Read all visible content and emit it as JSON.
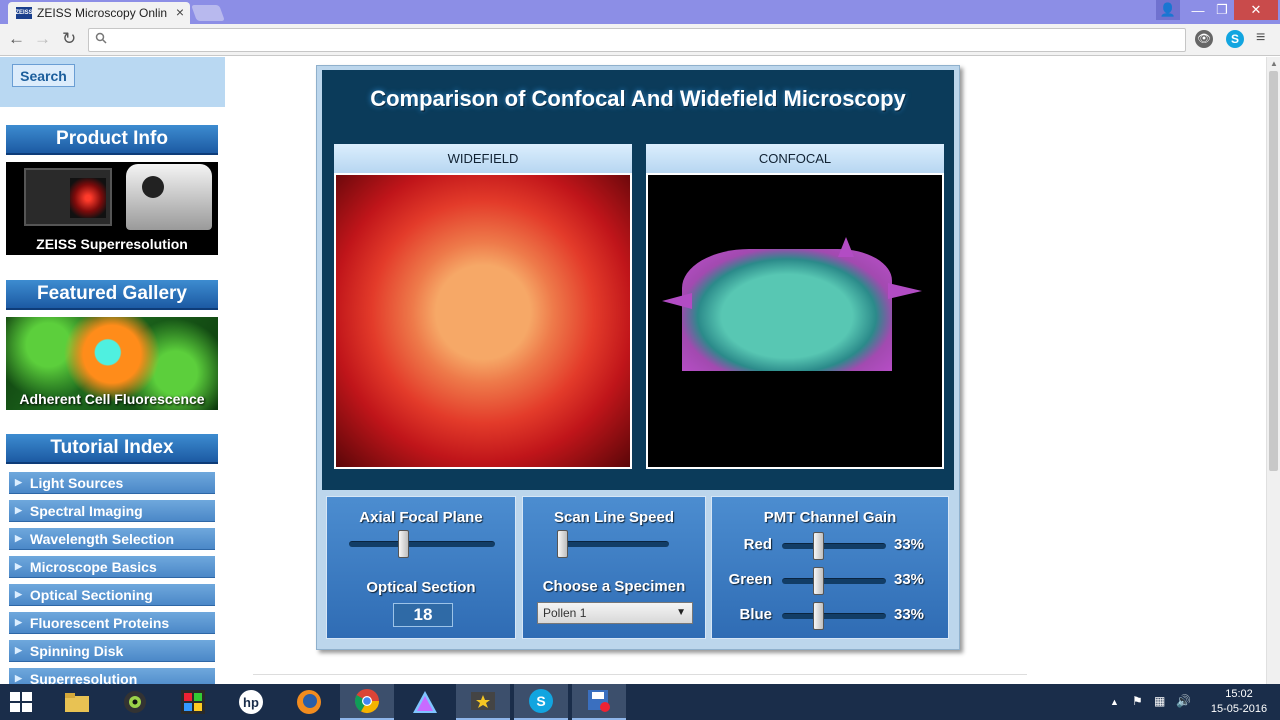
{
  "browser": {
    "tab_title": "ZEISS Microscopy Online C",
    "tab_logo_text": "ZEISS",
    "close_glyph": "×",
    "window_buttons": {
      "profile": "👤",
      "minimize": "—",
      "maximize": "❐",
      "close": "✕"
    },
    "nav": {
      "back": "←",
      "forward": "→",
      "reload": "↻",
      "menu": "≡"
    },
    "omnibox_value": "",
    "extensions": {
      "eye": "👁",
      "skype": "S"
    }
  },
  "sidebar": {
    "search_label": "Search",
    "product_info_header": "Product Info",
    "product_caption": "ZEISS Superresolution",
    "gallery_header": "Featured Gallery",
    "gallery_caption": "Adherent Cell Fluorescence",
    "tutorial_header": "Tutorial Index",
    "tutorial_items": [
      "Light Sources",
      "Spectral Imaging",
      "Wavelength Selection",
      "Microscope Basics",
      "Optical Sectioning",
      "Fluorescent Proteins",
      "Spinning Disk",
      "Superresolution"
    ]
  },
  "applet": {
    "title": "Comparison of Confocal And Widefield Microscopy",
    "widefield_label": "WIDEFIELD",
    "confocal_label": "CONFOCAL",
    "axial_label": "Axial Focal Plane",
    "axial_value": 0.36,
    "optical_section_label": "Optical Section",
    "optical_section_value": "18",
    "scan_speed_label": "Scan Line Speed",
    "scan_speed_value": 0.0,
    "specimen_label": "Choose a Specimen",
    "specimen_value": "Pollen 1",
    "specimen_arrow": "▼",
    "pmt_label": "PMT Channel Gain",
    "gains": [
      {
        "name": "Red",
        "percent": "33%",
        "value": 0.33
      },
      {
        "name": "Green",
        "percent": "33%",
        "value": 0.33
      },
      {
        "name": "Blue",
        "percent": "33%",
        "value": 0.33
      }
    ]
  },
  "taskbar": {
    "apps": [
      "file-explorer",
      "app-eye",
      "app-colors",
      "hp",
      "firefox",
      "chrome",
      "app-prism",
      "movie-maker",
      "skype",
      "app-record"
    ],
    "tray": {
      "up_arrow": "▲",
      "flag": "⚑",
      "network": "▦",
      "volume": "🔊"
    },
    "time": "15:02",
    "date": "15-05-2016"
  },
  "colors": {
    "titlebar": "#8c8ee6",
    "applet_bg": "#0b3b5a",
    "control_blue": "#4c8dd0",
    "sidebar_header": "#1c5aa3"
  }
}
